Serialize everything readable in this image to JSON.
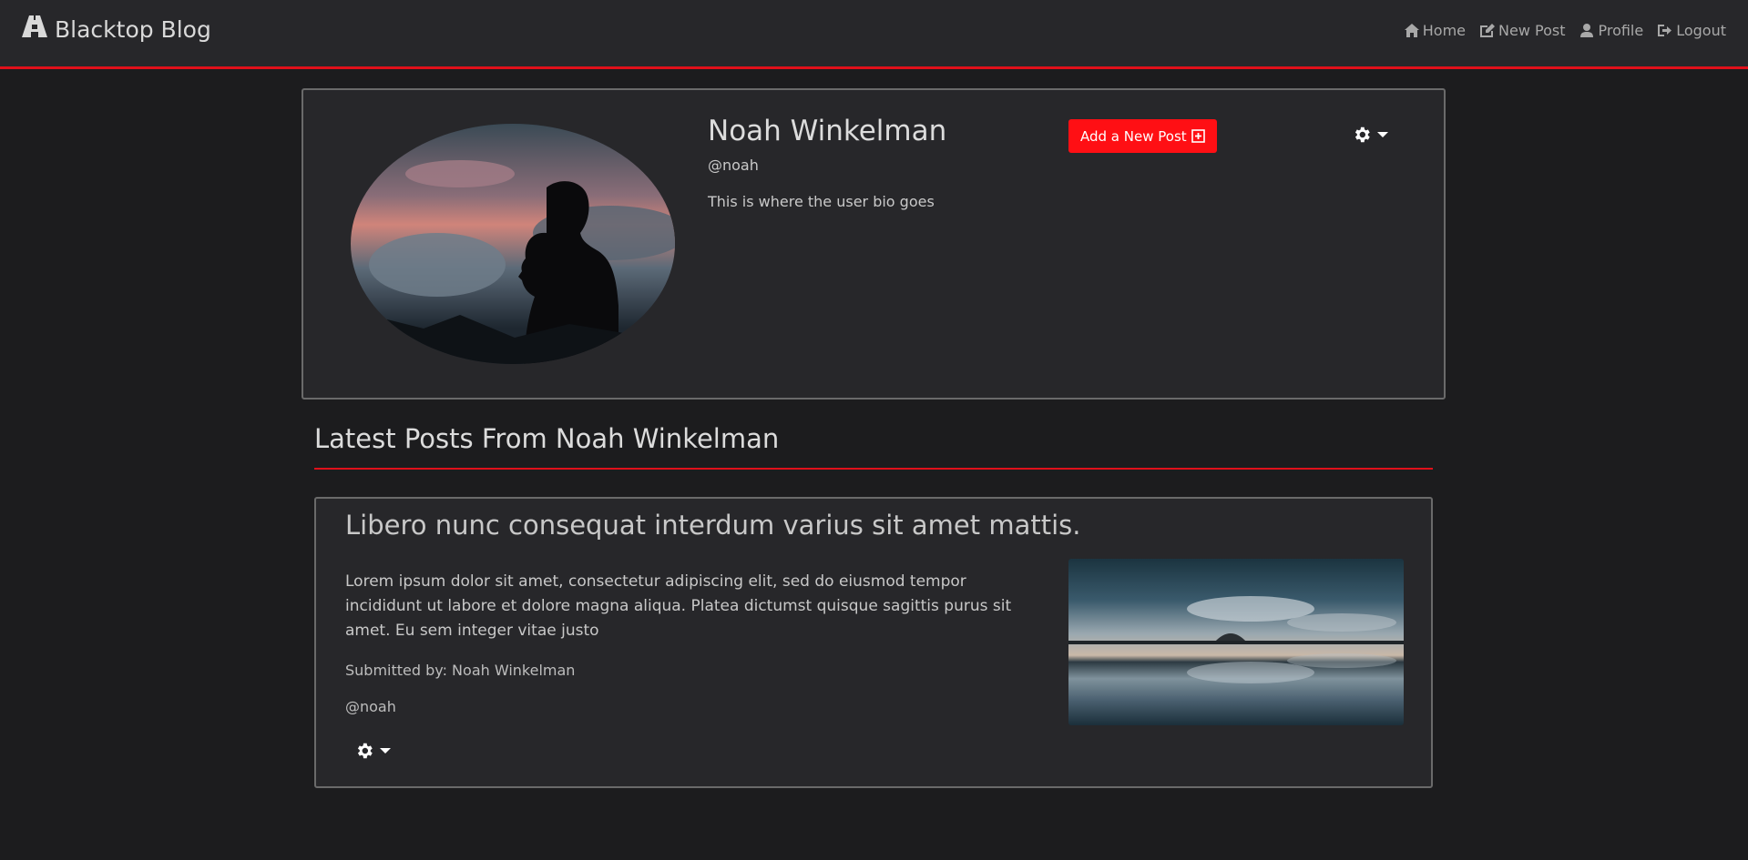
{
  "navbar": {
    "brand": "Blacktop Blog",
    "links": [
      {
        "label": "Home",
        "icon": "home-icon"
      },
      {
        "label": "New Post",
        "icon": "edit-icon"
      },
      {
        "label": "Profile",
        "icon": "user-icon"
      },
      {
        "label": "Logout",
        "icon": "sign-out-icon"
      }
    ]
  },
  "profile": {
    "name": "Noah Winkelman",
    "handle": "@noah",
    "bio": "This is where the user bio goes",
    "add_post_label": "Add a New Post"
  },
  "section": {
    "title": "Latest Posts From Noah Winkelman"
  },
  "posts": [
    {
      "title": "Libero nunc consequat interdum varius sit amet mattis.",
      "body": "Lorem ipsum dolor sit amet, consectetur adipiscing elit, sed do eiusmod tempor incididunt ut labore et dolore magna aliqua. Platea dictumst quisque sagittis purus sit amet. Eu sem integer vitae justo",
      "submitted_by": "Submitted by: Noah Winkelman",
      "handle": "@noah"
    }
  ],
  "colors": {
    "accent": "#e0101a",
    "button": "#ff0f14",
    "background": "#1c1c1e",
    "card": "#27272a"
  }
}
